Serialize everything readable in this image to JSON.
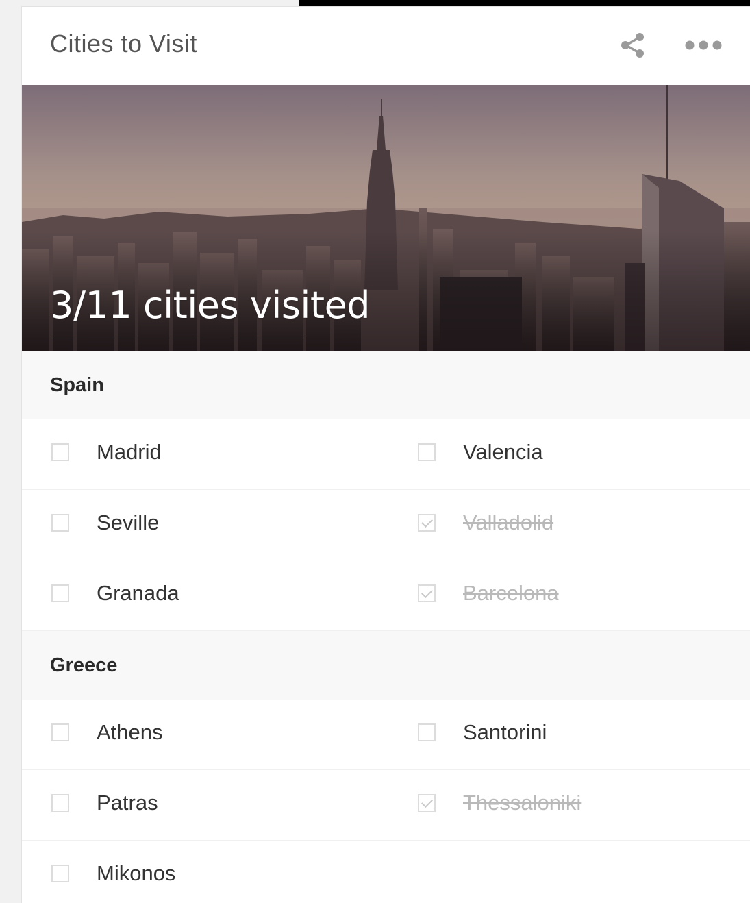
{
  "card": {
    "title": "Cities to Visit",
    "share_icon": "share-icon",
    "more_icon": "more-horizontal-icon"
  },
  "hero": {
    "progress_text": "3/11 cities visited",
    "visited": 3,
    "total": 11
  },
  "groups": [
    {
      "name": "Spain",
      "cities": [
        {
          "name": "Madrid",
          "checked": false
        },
        {
          "name": "Valencia",
          "checked": false
        },
        {
          "name": "Seville",
          "checked": false
        },
        {
          "name": "Valladolid",
          "checked": true
        },
        {
          "name": "Granada",
          "checked": false
        },
        {
          "name": "Barcelona",
          "checked": true
        }
      ]
    },
    {
      "name": "Greece",
      "cities": [
        {
          "name": "Athens",
          "checked": false
        },
        {
          "name": "Santorini",
          "checked": false
        },
        {
          "name": "Patras",
          "checked": false
        },
        {
          "name": "Thessaloniki",
          "checked": true
        },
        {
          "name": "Mikonos",
          "checked": false
        }
      ]
    }
  ]
}
